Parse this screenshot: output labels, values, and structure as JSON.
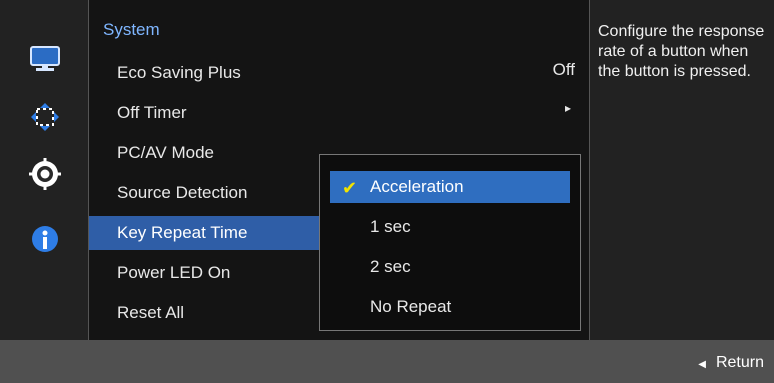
{
  "menu": {
    "title": "System",
    "items": [
      {
        "label": "Eco Saving Plus",
        "value": "Off"
      },
      {
        "label": "Off Timer"
      },
      {
        "label": "PC/AV Mode"
      },
      {
        "label": "Source Detection"
      },
      {
        "label": "Key Repeat Time",
        "active": true
      },
      {
        "label": "Power LED On"
      },
      {
        "label": "Reset All"
      }
    ]
  },
  "submenu": {
    "items": [
      {
        "label": "Acceleration",
        "selected": true
      },
      {
        "label": "1 sec"
      },
      {
        "label": "2 sec"
      },
      {
        "label": "No Repeat"
      }
    ]
  },
  "description": {
    "text": "Configure the response rate of a button when the button is pressed."
  },
  "footer": {
    "return_label": "Return"
  },
  "icons": [
    "monitor-icon",
    "move-icon",
    "gear-icon",
    "info-icon"
  ],
  "colors": {
    "accent": "#2f5ea7",
    "selected": "#2f6ec0",
    "title": "#7fb6ff",
    "check": "#f2e300"
  }
}
